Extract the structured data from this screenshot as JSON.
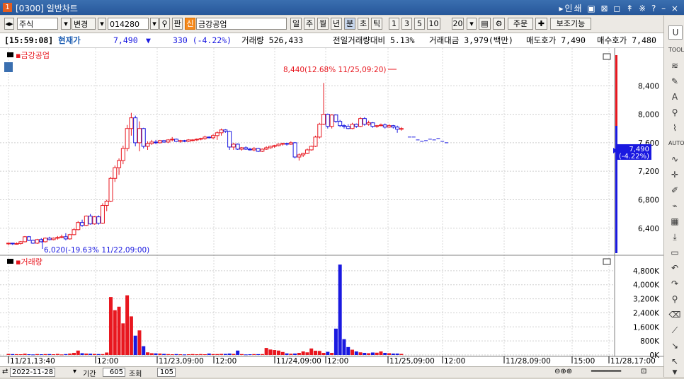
{
  "window": {
    "num": "1",
    "title": "[0300] 일반차트",
    "controls": "▸인쇄 ▣ ⊠ ◻ ↟ ※ ?  –  ×"
  },
  "toolbar": {
    "market": "주식",
    "change_btn": "변경",
    "code": "014280",
    "pan": "판",
    "name_badge": "신",
    "name": "금강공업",
    "periods": [
      "일",
      "주",
      "월",
      "년",
      "분",
      "초",
      "틱"
    ],
    "active_period": "분",
    "minutes": [
      "1",
      "3",
      "5",
      "10"
    ],
    "interval": "20",
    "order_btn": "주문",
    "aux_btn": "보조기능"
  },
  "info": {
    "time": "[15:59:08]",
    "label_price": "현재가",
    "price": "7,490",
    "arrow": "▼",
    "change": "330 (-4.22%)",
    "volume": "거래량 526,433",
    "vol_ratio": "전일거래량대비 5.13%",
    "amount": "거래대금 3,979(백만)",
    "ask": "매도호가 7,490",
    "bid": "매수호가 7,480"
  },
  "chart_data": [
    {
      "type": "candlestick",
      "title": "금강공업",
      "ylim": [
        6050,
        8850
      ],
      "y_ticks": [
        "8,400",
        "8,000",
        "7,600",
        "7,200",
        "6,800",
        "6,400"
      ],
      "current_label": "7,490",
      "current_pct": "(-4.22%)",
      "high_annotation": "8,440(12.68% 11/25,09:20)",
      "low_annotation": "6,020(-19.63% 11/22,09:00)",
      "candles": [
        [
          6180,
          6200,
          6160,
          6190
        ],
        [
          6190,
          6195,
          6165,
          6180
        ],
        [
          6180,
          6200,
          6170,
          6185
        ],
        [
          6185,
          6220,
          6170,
          6210
        ],
        [
          6210,
          6290,
          6200,
          6280
        ],
        [
          6280,
          6290,
          6220,
          6230
        ],
        [
          6230,
          6240,
          6180,
          6190
        ],
        [
          6190,
          6250,
          6180,
          6240
        ],
        [
          6240,
          6260,
          6200,
          6210
        ],
        [
          6210,
          6270,
          6200,
          6260
        ],
        [
          6260,
          6280,
          6230,
          6240
        ],
        [
          6240,
          6270,
          6230,
          6260
        ],
        [
          6260,
          6290,
          6240,
          6270
        ],
        [
          6270,
          6310,
          6260,
          6280
        ],
        [
          6280,
          6330,
          6230,
          6250
        ],
        [
          6250,
          6320,
          6240,
          6310
        ],
        [
          6310,
          6400,
          6300,
          6380
        ],
        [
          6380,
          6500,
          6370,
          6480
        ],
        [
          6480,
          6520,
          6420,
          6440
        ],
        [
          6440,
          6580,
          6430,
          6570
        ],
        [
          6570,
          6600,
          6450,
          6460
        ],
        [
          6460,
          6570,
          6450,
          6560
        ],
        [
          6560,
          6580,
          6450,
          6470
        ],
        [
          6470,
          6750,
          6460,
          6720
        ],
        [
          6720,
          6800,
          6640,
          6780
        ],
        [
          6780,
          7120,
          6770,
          7100
        ],
        [
          7100,
          7280,
          7050,
          7250
        ],
        [
          7250,
          7380,
          7150,
          7350
        ],
        [
          7350,
          7560,
          7300,
          7520
        ],
        [
          7520,
          7850,
          7480,
          7800
        ],
        [
          7800,
          8020,
          7700,
          7950
        ],
        [
          7950,
          7980,
          7550,
          7600
        ],
        [
          7600,
          7900,
          7480,
          7800
        ],
        [
          7800,
          7810,
          7520,
          7550
        ],
        [
          7550,
          7620,
          7500,
          7590
        ],
        [
          7590,
          7640,
          7570,
          7610
        ],
        [
          7610,
          7640,
          7580,
          7600
        ],
        [
          7600,
          7640,
          7590,
          7630
        ],
        [
          7630,
          7640,
          7600,
          7610
        ],
        [
          7610,
          7650,
          7595,
          7640
        ],
        [
          7640,
          7680,
          7620,
          7650
        ],
        [
          7650,
          7660,
          7610,
          7620
        ],
        [
          7620,
          7640,
          7600,
          7630
        ],
        [
          7630,
          7640,
          7610,
          7620
        ],
        [
          7620,
          7650,
          7610,
          7640
        ],
        [
          7640,
          7650,
          7620,
          7640
        ],
        [
          7640,
          7660,
          7625,
          7650
        ],
        [
          7650,
          7670,
          7635,
          7660
        ],
        [
          7660,
          7700,
          7640,
          7680
        ],
        [
          7680,
          7690,
          7660,
          7670
        ],
        [
          7670,
          7720,
          7650,
          7700
        ],
        [
          7700,
          7760,
          7640,
          7740
        ],
        [
          7740,
          7800,
          7700,
          7780
        ],
        [
          7780,
          7790,
          7740,
          7760
        ],
        [
          7760,
          7770,
          7500,
          7540
        ],
        [
          7540,
          7600,
          7500,
          7580
        ],
        [
          7580,
          7590,
          7500,
          7510
        ],
        [
          7510,
          7540,
          7490,
          7530
        ],
        [
          7530,
          7550,
          7500,
          7510
        ],
        [
          7510,
          7530,
          7490,
          7500
        ],
        [
          7500,
          7540,
          7480,
          7520
        ],
        [
          7520,
          7530,
          7470,
          7480
        ],
        [
          7480,
          7520,
          7470,
          7510
        ],
        [
          7510,
          7550,
          7500,
          7530
        ],
        [
          7530,
          7560,
          7515,
          7550
        ],
        [
          7550,
          7570,
          7530,
          7560
        ],
        [
          7560,
          7590,
          7550,
          7580
        ],
        [
          7580,
          7600,
          7560,
          7590
        ],
        [
          7590,
          7600,
          7560,
          7580
        ],
        [
          7580,
          7620,
          7570,
          7600
        ],
        [
          7600,
          7610,
          7380,
          7400
        ],
        [
          7400,
          7450,
          7350,
          7430
        ],
        [
          7430,
          7460,
          7400,
          7450
        ],
        [
          7450,
          7520,
          7440,
          7500
        ],
        [
          7500,
          7560,
          7490,
          7550
        ],
        [
          7550,
          7700,
          7540,
          7680
        ],
        [
          7680,
          7880,
          7660,
          7860
        ],
        [
          7860,
          8440,
          7850,
          8000
        ],
        [
          8000,
          8010,
          7800,
          7830
        ],
        [
          7830,
          8000,
          7800,
          7990
        ],
        [
          7990,
          8000,
          7880,
          7900
        ],
        [
          7900,
          7920,
          7820,
          7840
        ],
        [
          7840,
          7860,
          7800,
          7830
        ],
        [
          7830,
          7860,
          7790,
          7800
        ],
        [
          7800,
          7880,
          7790,
          7860
        ],
        [
          7860,
          7870,
          7810,
          7830
        ],
        [
          7830,
          7960,
          7820,
          7940
        ],
        [
          7940,
          7960,
          7840,
          7860
        ],
        [
          7860,
          7910,
          7840,
          7880
        ],
        [
          7880,
          7890,
          7810,
          7830
        ],
        [
          7830,
          7850,
          7810,
          7840
        ],
        [
          7840,
          7870,
          7830,
          7850
        ],
        [
          7850,
          7870,
          7800,
          7820
        ],
        [
          7820,
          7860,
          7810,
          7840
        ],
        [
          7840,
          7850,
          7800,
          7820
        ],
        [
          7820,
          7840,
          7740,
          7790
        ],
        [
          7790,
          7820,
          7770,
          7800
        ]
      ],
      "pending": [
        7680,
        7680,
        7640,
        7620,
        7630,
        7650,
        7640,
        7660,
        7620,
        7600
      ]
    },
    {
      "type": "bar",
      "title": "거래량",
      "ylim": [
        0,
        5400000
      ],
      "y_ticks": [
        "4,800K",
        "4,000K",
        "3,200K",
        "2,400K",
        "1,600K",
        "800K",
        "0K"
      ],
      "x_ticks": [
        "11/21,13:40",
        "12:00",
        "11/23,09:00",
        "12:00",
        "11/24,09:00",
        "12:00",
        "11/25,09:00",
        "12:00",
        "11/28,09:00",
        "15:00",
        "11/28,17:00"
      ],
      "values": [
        60000,
        50000,
        45000,
        40000,
        70000,
        40000,
        30000,
        50000,
        40000,
        50000,
        50000,
        40000,
        60000,
        30000,
        50000,
        80000,
        120000,
        250000,
        100000,
        80000,
        70000,
        60000,
        50000,
        50000,
        140000,
        3300000,
        2550000,
        2750000,
        1800000,
        3400000,
        2200000,
        1100000,
        1400000,
        500000,
        150000,
        100000,
        90000,
        80000,
        60000,
        50000,
        40000,
        50000,
        40000,
        30000,
        40000,
        50000,
        40000,
        50000,
        40000,
        80000,
        50000,
        50000,
        60000,
        60000,
        80000,
        60000,
        250000,
        50000,
        30000,
        40000,
        50000,
        45000,
        50000,
        400000,
        310000,
        280000,
        250000,
        170000,
        90000,
        70000,
        80000,
        120000,
        200000,
        150000,
        370000,
        240000,
        230000,
        120000,
        180000,
        120000,
        1500000,
        5150000,
        900000,
        450000,
        300000,
        200000,
        150000,
        120000,
        100000,
        140000,
        130000,
        200000,
        120000,
        100000,
        80000,
        80000,
        60000
      ],
      "colors_up": "#e8171f",
      "colors_down": "#1a19e0"
    }
  ],
  "bottom": {
    "date": "2022-11-28",
    "period_label": "기간",
    "period_value": "605",
    "query": "조회",
    "count": "105"
  }
}
